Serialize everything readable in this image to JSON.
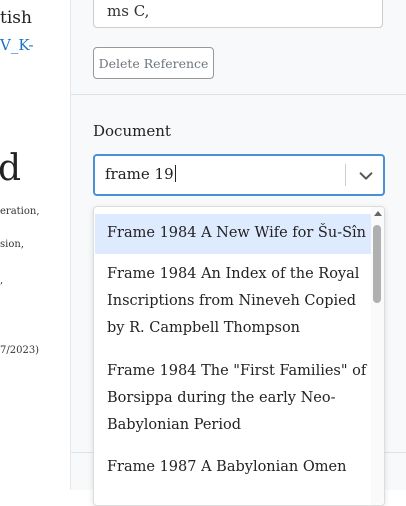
{
  "left": {
    "title_fragment": "tish",
    "link_fragment": "V_K-",
    "big_fragment": "d",
    "small_lines": [
      "eration,",
      "sion,",
      ",",
      "7/2023)"
    ]
  },
  "panel": {
    "reference_value": "ms C,",
    "delete_label": "Delete Reference",
    "document_label": "Document",
    "document_input": "frame 19",
    "options": [
      "Frame 1984 A New Wife for Šu-Sîn",
      "Frame 1984 An Index of the Royal Inscriptions from Nineveh Copied by R. Campbell Thompson",
      "Frame 1984 The \"First Families\" of Borsippa during the early Neo-Babylonian Period",
      "Frame 1987 A Babylonian Omen"
    ]
  }
}
